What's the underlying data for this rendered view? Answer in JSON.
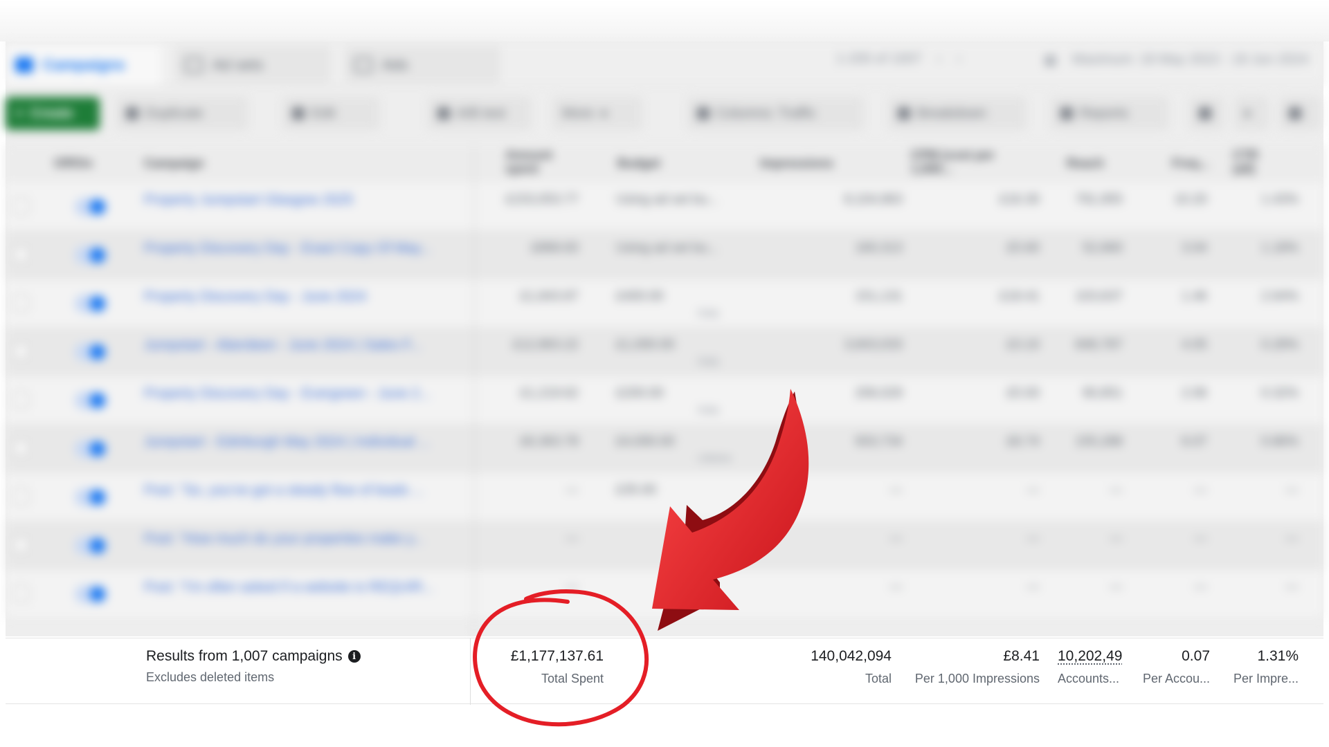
{
  "tabs": [
    {
      "label": "Campaigns",
      "active": true
    },
    {
      "label": "Ad sets",
      "active": false
    },
    {
      "label": "Ads",
      "active": false
    }
  ],
  "pagination": "1-200 of 1007",
  "date_range": "Maximum: 18 May 2022 - 18 Jun 2024",
  "toolbar": {
    "create": "Create",
    "duplicate": "Duplicate",
    "edit": "Edit",
    "ab_test": "A/B test",
    "more": "More",
    "columns": "Columns: Traffic",
    "breakdown": "Breakdown",
    "reports": "Reports"
  },
  "columns": {
    "off_on": "Off/On",
    "campaign": "Campaign",
    "amount_spent": "Amount spent",
    "budget": "Budget",
    "impressions": "Impressions",
    "cpm": "CPM (cost per 1,000...",
    "reach": "Reach",
    "frequency": "Freq...",
    "ctr": "CTR (all)"
  },
  "rows": [
    {
      "campaign": "Property Jumpstart Glasgow 2025",
      "spent": "£153,053.77",
      "budget": "Using ad set bu...",
      "budget_sub": "",
      "impressions": "8,104,963",
      "cpm": "£16.30",
      "reach": "791,955",
      "freq": "10.20",
      "ctr": "1.43%"
    },
    {
      "campaign": "Property Discovery Day - Exact Copy Of May...",
      "spent": "£868.83",
      "budget": "Using ad set bu...",
      "budget_sub": "",
      "impressions": "160,313",
      "cpm": "£5.60",
      "reach": "52,660",
      "freq": "3.04",
      "ctr": "1.18%"
    },
    {
      "campaign": "Property Discovery Day - June 2024",
      "spent": "£1,843.87",
      "budget": "£400.00",
      "budget_sub": "Daily",
      "impressions": "151,131",
      "cpm": "£18.41",
      "reach": "103,637",
      "freq": "1.46",
      "ctr": "2.64%"
    },
    {
      "campaign": "Jumpstart - Aberdeen - June 2024 | Sales F...",
      "spent": "£12,863.22",
      "budget": "£1,000.00",
      "budget_sub": "Daily",
      "impressions": "3,843,033",
      "cpm": "£3.10",
      "reach": "848,787",
      "freq": "4.05",
      "ctr": "0.28%"
    },
    {
      "campaign": "Property Discovery Day - Evergreen - June 2...",
      "spent": "£1,219.62",
      "budget": "£200.00",
      "budget_sub": "Daily",
      "impressions": "206,029",
      "cpm": "£5.93",
      "reach": "90,851",
      "freq": "2.06",
      "ctr": "0.32%"
    },
    {
      "campaign": "Jumpstart - Edinburgh May 2024 | Individual ...",
      "spent": "£6,363.78",
      "budget": "£4,000.00",
      "budget_sub": "Lifetime",
      "impressions": "933,734",
      "cpm": "£6.74",
      "reach": "155,288",
      "freq": "6.07",
      "ctr": "0.86%"
    },
    {
      "campaign": "Post: \"So, you've got a steady flow of leads ...",
      "spent": "—",
      "budget": "£35.00",
      "budget_sub": "",
      "impressions": "—",
      "cpm": "—",
      "reach": "—",
      "freq": "—",
      "ctr": "—"
    },
    {
      "campaign": "Post: \"How much do your properties make y...",
      "spent": "—",
      "budget": "",
      "budget_sub": "",
      "impressions": "—",
      "cpm": "—",
      "reach": "—",
      "freq": "—",
      "ctr": "—"
    },
    {
      "campaign": "Post: \"I'm often asked if a website is REQUIR...",
      "spent": "—",
      "budget": "",
      "budget_sub": "",
      "impressions": "—",
      "cpm": "—",
      "reach": "—",
      "freq": "—",
      "ctr": "—"
    }
  ],
  "summary": {
    "title": "Results from 1,007 campaigns",
    "subtitle": "Excludes deleted items",
    "total_spent": "£1,177,137.61",
    "total_spent_label": "Total Spent",
    "impressions": "140,042,094",
    "impressions_label": "Total",
    "cpm": "£8.41",
    "cpm_label": "Per 1,000 Impressions",
    "reach": "10,202,49",
    "reach_label": "Accounts...",
    "frequency": "0.07",
    "frequency_label": "Per Accou...",
    "ctr": "1.31%",
    "ctr_label": "Per Impre..."
  },
  "annotation": {
    "arrow_color": "#e8232a",
    "circle_color": "#e41e26"
  }
}
